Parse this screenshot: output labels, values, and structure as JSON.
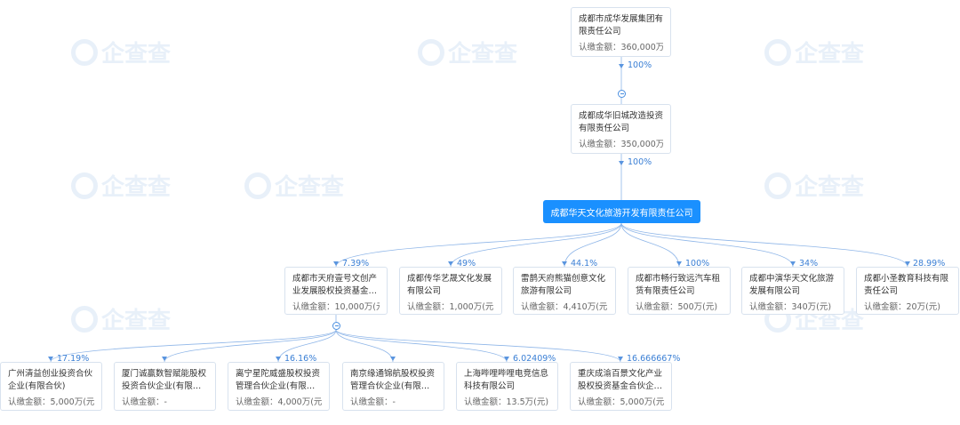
{
  "watermark": "企查查",
  "chain": [
    {
      "name": "成都市成华发展集团有限责任公司",
      "amount": "认缴金额：360,000万(..."
    },
    {
      "name": "成都成华旧城改造投资有限责任公司",
      "amount": "认缴金额：350,000万(..."
    }
  ],
  "chain_pcts": [
    "100%",
    "100%"
  ],
  "main_company": "成都华天文化旅游开发有限责任公司",
  "investments": [
    {
      "pct": "7.39%",
      "name": "成都市天府壹号文创产业发展股权投资基金合伙企业...",
      "amount": "认缴金额：10,000万(元..."
    },
    {
      "pct": "49%",
      "name": "成都传华艺晟文化发展有限公司",
      "amount": "认缴金额：1,000万(元)"
    },
    {
      "pct": "44.1%",
      "name": "雷鹊天府熊猫创意文化旅游有限公司",
      "amount": "认缴金额：4,410万(元)"
    },
    {
      "pct": "100%",
      "name": "成都市畅行致远汽车租赁有限责任公司",
      "amount": "认缴金额：500万(元)"
    },
    {
      "pct": "34%",
      "name": "成都中演华天文化旅游发展有限公司",
      "amount": "认缴金额：340万(元)"
    },
    {
      "pct": "28.99%",
      "name": "成都小圣教育科技有限责任公司",
      "amount": "认缴金额：20万(元)"
    }
  ],
  "sub_investments": [
    {
      "pct": "17.19%",
      "name": "广州清益创业投资合伙企业(有限合伙)",
      "amount": "认缴金额：5,000万(元)"
    },
    {
      "pct": "",
      "name": "厦门诚赢数智赋能股权投资合伙企业(有限合伙)",
      "amount": "认缴金额：-"
    },
    {
      "pct": "16.16%",
      "name": "离宁星陀威盛股权投资管理合伙企业(有限合伙)",
      "amount": "认缴金额：4,000万(元)"
    },
    {
      "pct": "",
      "name": "南京缘通锦航股权投资管理合伙企业(有限合伙)",
      "amount": "认缴金额：-"
    },
    {
      "pct": "6.02409%",
      "name": "上海哔哩哔哩电竞信息科技有限公司",
      "amount": "认缴金额：13.5万(元)"
    },
    {
      "pct": "16.666667%",
      "name": "重庆成渝百景文化产业股权投资基金合伙企业(有限...",
      "amount": "认缴金额：5,000万(元)"
    }
  ],
  "colors": {
    "accent": "#1a90ff",
    "percent": "#3a7fd5",
    "line": "#8fb6e8",
    "border": "#d8e2ee"
  }
}
